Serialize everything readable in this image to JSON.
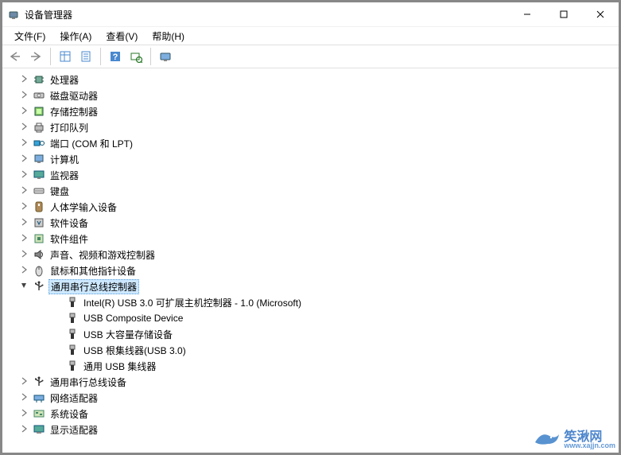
{
  "window": {
    "title": "设备管理器"
  },
  "menu": {
    "file": "文件(F)",
    "action": "操作(A)",
    "view": "查看(V)",
    "help": "帮助(H)"
  },
  "tree": {
    "selected": "通用串行总线控制器",
    "items": [
      {
        "icon": "cpu",
        "label": "处理器"
      },
      {
        "icon": "disk",
        "label": "磁盘驱动器"
      },
      {
        "icon": "storage",
        "label": "存储控制器"
      },
      {
        "icon": "printer",
        "label": "打印队列"
      },
      {
        "icon": "port",
        "label": "端口 (COM 和 LPT)"
      },
      {
        "icon": "pc",
        "label": "计算机"
      },
      {
        "icon": "monitor",
        "label": "监视器"
      },
      {
        "icon": "keyboard",
        "label": "键盘"
      },
      {
        "icon": "hid",
        "label": "人体学输入设备"
      },
      {
        "icon": "swdev",
        "label": "软件设备"
      },
      {
        "icon": "swcomp",
        "label": "软件组件"
      },
      {
        "icon": "audio",
        "label": "声音、视频和游戏控制器"
      },
      {
        "icon": "mouse",
        "label": "鼠标和其他指针设备"
      },
      {
        "icon": "usb",
        "label": "通用串行总线控制器",
        "expanded": true,
        "selected": true,
        "children": [
          {
            "icon": "usb-plug",
            "label": "Intel(R) USB 3.0 可扩展主机控制器 - 1.0 (Microsoft)"
          },
          {
            "icon": "usb-plug",
            "label": "USB Composite Device"
          },
          {
            "icon": "usb-plug",
            "label": "USB 大容量存储设备"
          },
          {
            "icon": "usb-plug",
            "label": "USB 根集线器(USB 3.0)"
          },
          {
            "icon": "usb-plug",
            "label": "通用 USB 集线器"
          }
        ]
      },
      {
        "icon": "usb",
        "label": "通用串行总线设备"
      },
      {
        "icon": "network",
        "label": "网络适配器"
      },
      {
        "icon": "system",
        "label": "系统设备"
      },
      {
        "icon": "display",
        "label": "显示适配器"
      }
    ]
  },
  "watermark": {
    "text": "笶湫网",
    "url": "www.xajjn.com"
  }
}
